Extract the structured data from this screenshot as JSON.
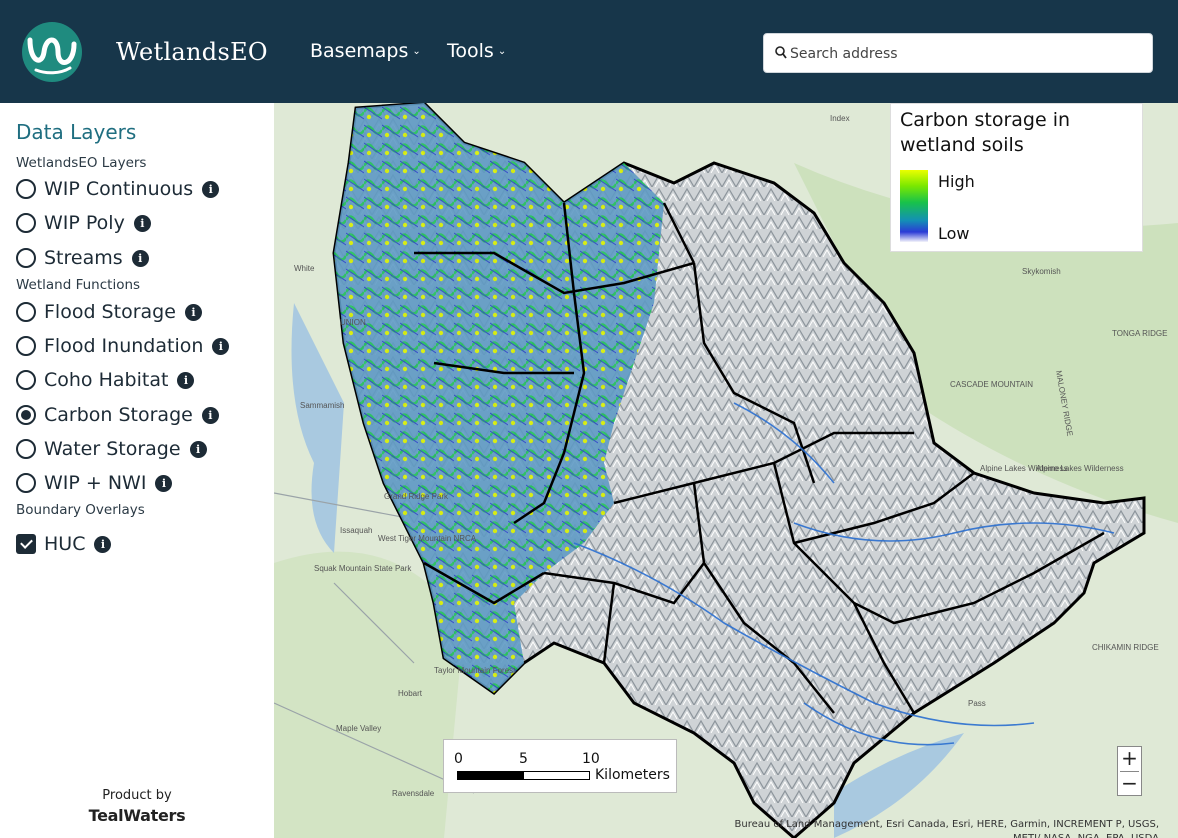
{
  "header": {
    "app_title": "WetlandsEO",
    "menus": [
      "Basemaps",
      "Tools"
    ],
    "search_placeholder": "Search address"
  },
  "sidebar": {
    "title": "Data Layers",
    "sections": [
      {
        "label": "WetlandsEO Layers",
        "items": [
          {
            "label": "WIP Continuous",
            "control": "radio",
            "selected": false
          },
          {
            "label": "WIP Poly",
            "control": "radio",
            "selected": false
          },
          {
            "label": "Streams",
            "control": "radio",
            "selected": false
          }
        ]
      },
      {
        "label": "Wetland Functions",
        "items": [
          {
            "label": "Flood Storage",
            "control": "radio",
            "selected": false
          },
          {
            "label": "Flood Inundation",
            "control": "radio",
            "selected": false
          },
          {
            "label": "Coho Habitat",
            "control": "radio",
            "selected": false
          },
          {
            "label": "Carbon Storage",
            "control": "radio",
            "selected": true
          },
          {
            "label": "Water Storage",
            "control": "radio",
            "selected": false
          },
          {
            "label": "WIP + NWI",
            "control": "radio",
            "selected": false
          }
        ]
      },
      {
        "label": "Boundary Overlays",
        "items": [
          {
            "label": "HUC",
            "control": "checkbox",
            "checked": true
          }
        ]
      }
    ],
    "info_glyph": "i",
    "footer": {
      "product_by": "Product by",
      "brand": "TealWaters"
    }
  },
  "map": {
    "legend": {
      "title": "Carbon storage in wetland soils",
      "high": "High",
      "low": "Low"
    },
    "scalebar": {
      "ticks": [
        "0",
        "5",
        "10"
      ],
      "unit": "Kilometers"
    },
    "zoom": {
      "in": "+",
      "out": "−"
    },
    "attribution": "Bureau of Land Management, Esri Canada, Esri, HERE, Garmin, INCREMENT P, USGS, METI/ NASA, NGA, EPA, USDA",
    "place_labels": [
      "Sammamish",
      "UNION",
      "White",
      "Index",
      "Skykomish",
      "TONGA RIDGE",
      "CASCADE MOUNTAIN",
      "MALONEY RIDGE",
      "Alpine Lakes Wilderness",
      "Alpine Lakes Wilderness",
      "CHIKAMIN RIDGE",
      "Grand Ridge Park",
      "Issaquah",
      "West Tiger Mountain NRCA",
      "Squak Mountain State Park",
      "Taylor Mountain Forest",
      "Hobart",
      "Maple Valley",
      "Ravensdale",
      "Pass"
    ]
  },
  "colors": {
    "header_bg": "#17364a",
    "logo_bg": "#1f8b7f",
    "panel_title": "#1f6e80",
    "control": "#1d2b36",
    "map_bg": "#dfe9d6",
    "ramp_high": "#eaff00",
    "ramp_low": "#2b3bd6"
  },
  "icons": [
    "logo-icon",
    "search-icon",
    "chevron-down-icon",
    "info-icon",
    "zoom-in-icon",
    "zoom-out-icon"
  ]
}
